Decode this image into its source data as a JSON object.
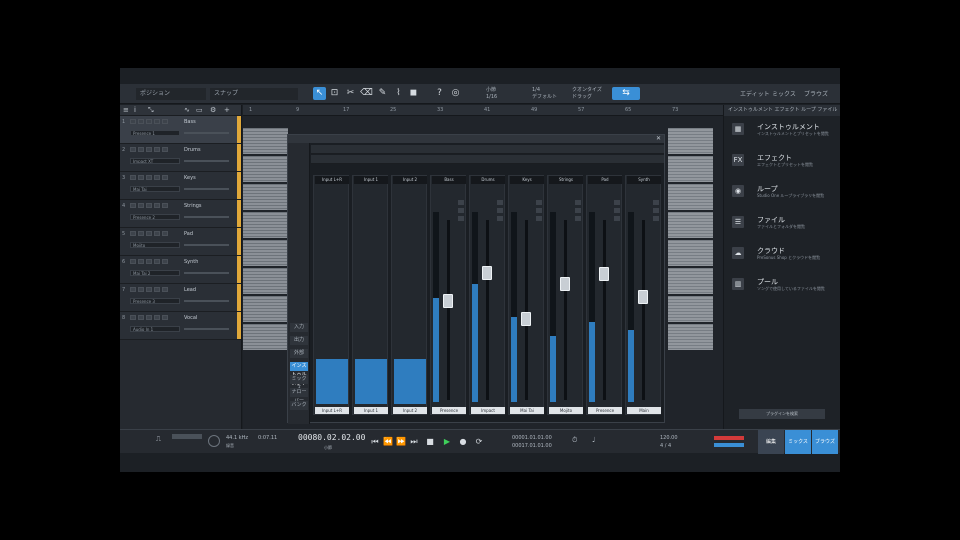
{
  "toolbar": {
    "field_left": "ポジション",
    "field_mid": "スナップ",
    "transport_info": [
      "小節",
      "1/16",
      "1/4",
      "デフォルト",
      "クオンタイズ",
      "ドラッグ"
    ],
    "right_labels": [
      "エディット",
      "ミックス",
      "ブラウズ"
    ]
  },
  "tracks": [
    {
      "num": "1",
      "name": "Bass",
      "inst": "Presence 1"
    },
    {
      "num": "2",
      "name": "Drums",
      "inst": "Impact XT"
    },
    {
      "num": "3",
      "name": "Keys",
      "inst": "Mai Tai"
    },
    {
      "num": "4",
      "name": "Strings",
      "inst": "Presence 2"
    },
    {
      "num": "5",
      "name": "Pad",
      "inst": "Mojito"
    },
    {
      "num": "6",
      "name": "Synth",
      "inst": "Mai Tai 2"
    },
    {
      "num": "7",
      "name": "Lead",
      "inst": "Presence 3"
    },
    {
      "num": "8",
      "name": "Vocal",
      "inst": "Audio In 1"
    }
  ],
  "ruler": [
    "1",
    "9",
    "17",
    "25",
    "33",
    "41",
    "49",
    "57",
    "65",
    "73"
  ],
  "mixer": {
    "side_buttons": [
      "入力",
      "出力",
      "外部",
      "インストゥルメント",
      "ミックス",
      "ナローバー",
      "バンク"
    ],
    "inputs": [
      "Input L+R",
      "Input 1",
      "Input 2"
    ],
    "channels": [
      "Bass",
      "Drums",
      "Keys",
      "Strings",
      "Pad",
      "Synth"
    ],
    "main": "Main",
    "strip_bottom": [
      "Input L+R",
      "Input 1",
      "Input 2",
      "Presence",
      "Impact",
      "Mai Tai",
      "Mojito",
      "Presence",
      "Main"
    ]
  },
  "browser": {
    "tabs": "インストゥルメント  エフェクト  ループ  ファイル",
    "items": [
      {
        "icon": "piano-icon",
        "glyph": "▦",
        "title": "インストゥルメント",
        "desc": "インストゥルメントとプリセットを閲覧"
      },
      {
        "icon": "fx-icon",
        "glyph": "FX",
        "title": "エフェクト",
        "desc": "エフェクトとプリセットを閲覧"
      },
      {
        "icon": "loop-icon",
        "glyph": "◉",
        "title": "ループ",
        "desc": "Studio One ループライブラリを閲覧"
      },
      {
        "icon": "file-icon",
        "glyph": "☰",
        "title": "ファイル",
        "desc": "ファイルとフォルダを閲覧"
      },
      {
        "icon": "cloud-icon",
        "glyph": "☁",
        "title": "クラウド",
        "desc": "PreSonus Shop とクラウドを閲覧"
      },
      {
        "icon": "pool-icon",
        "glyph": "▥",
        "title": "プール",
        "desc": "ソングで使用しているファイルを閲覧"
      }
    ],
    "button": "プラグインを検索"
  },
  "transport": {
    "timecode": "00080.02.02.00",
    "tc_label": "小節",
    "cpu": "44.1 kHz",
    "rec": "録音",
    "pos1": "0:07.11",
    "loop_start": "00001.01.01.00",
    "loop_end": "00017.01.01.00",
    "tempo": "120.00",
    "sig": "4 / 4",
    "tabs": [
      "編集",
      "ミックス",
      "ブラウズ"
    ]
  }
}
